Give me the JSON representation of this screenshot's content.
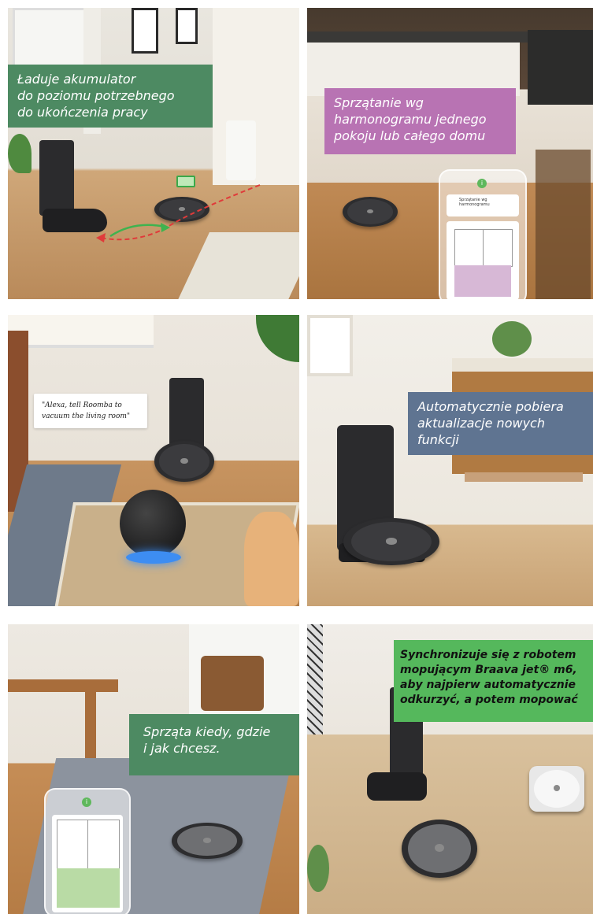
{
  "tiles": [
    {
      "caption": "Ładuje akumulator\ndo poziomu potrzebnego\ndo ukończenia pracy",
      "caption_color": "#4d8a62"
    },
    {
      "caption": "Sprzątanie wg\nharmonogramu jednego\npokoju lub całego domu",
      "caption_color": "#b873b3",
      "phone_card_title": "Sprzątanie wg harmonogramu"
    },
    {
      "caption": "\"Alexa, tell Roomba to\nvacuum the living room\""
    },
    {
      "caption": "Automatycznie pobiera\naktualizacje nowych\nfunkcji",
      "caption_color": "#5f7491"
    },
    {
      "caption": "Sprząta kiedy, gdzie\ni jak chcesz.",
      "caption_color": "#4d8a62"
    },
    {
      "caption": "Synchronizuje się z robotem\nmopującym Braava jet® m6,\naby najpierw automatycznie\nodkurzyć, a potem mopować",
      "caption_color": "#55b85c"
    }
  ],
  "icons": {
    "battery": "battery-icon",
    "app": "app-logo-icon"
  }
}
